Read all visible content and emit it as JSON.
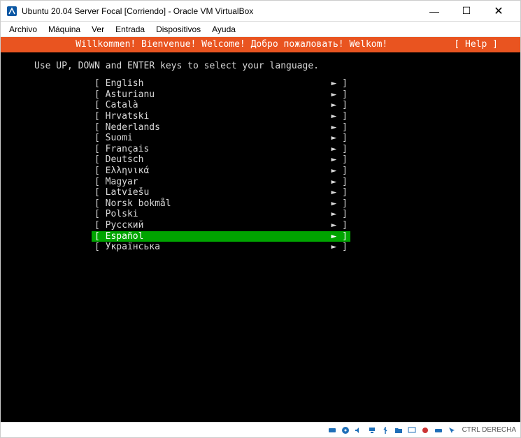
{
  "window": {
    "title": "Ubuntu 20.04 Server Focal [Corriendo] - Oracle VM VirtualBox"
  },
  "menu": {
    "items": [
      "Archivo",
      "Máquina",
      "Ver",
      "Entrada",
      "Dispositivos",
      "Ayuda"
    ]
  },
  "banner": {
    "welcome": "Willkommen! Bienvenue! Welcome! Добро пожаловать! Welkom!",
    "help": "[ Help ]"
  },
  "hint": "Use UP, DOWN and ENTER keys to select your language.",
  "languages": {
    "selected_index": 14,
    "items": [
      "English",
      "Asturianu",
      "Català",
      "Hrvatski",
      "Nederlands",
      "Suomi",
      "Français",
      "Deutsch",
      "Ελληνικά",
      "Magyar",
      "Latviešu",
      "Norsk bokmål",
      "Polski",
      "Русский",
      "Español",
      "Українська"
    ]
  },
  "statusbar": {
    "host_key": "CTRL DERECHA"
  },
  "colors": {
    "accent": "#e95420",
    "selection": "#00a400"
  }
}
